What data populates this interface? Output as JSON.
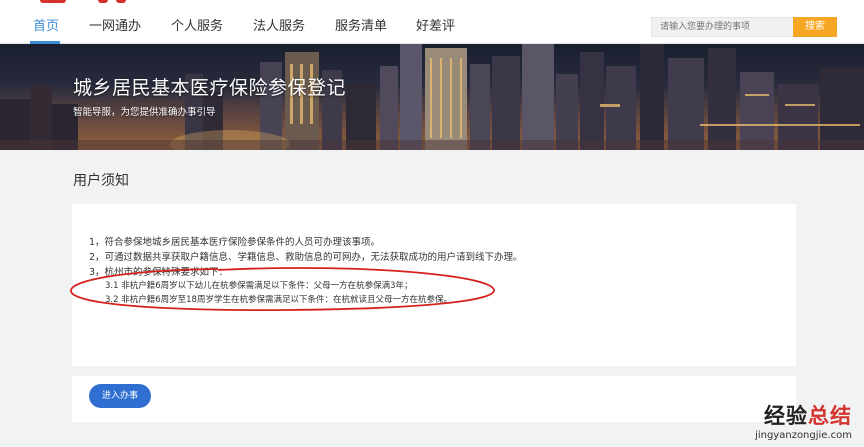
{
  "nav": {
    "items": [
      {
        "label": "首页",
        "active": true
      },
      {
        "label": "一网通办"
      },
      {
        "label": "个人服务"
      },
      {
        "label": "法人服务"
      },
      {
        "label": "服务清单"
      },
      {
        "label": "好差评"
      }
    ],
    "search_placeholder": "请输入您要办理的事项",
    "search_button": "搜索",
    "accent_color": "#3c8ed6",
    "search_button_color": "#f6a623"
  },
  "banner": {
    "title": "城乡居民基本医疗保险参保登记",
    "subtitle": "智能导服，为您提供准确办事引导"
  },
  "notice": {
    "heading": "用户须知",
    "lines": [
      "1，符合参保地城乡居民基本医疗保险参保条件的人员可办理该事项。",
      "2，可通过数据共享获取户籍信息、学籍信息、救助信息的可网办，无法获取成功的用户请到线下办理。",
      "3，杭州市的参保特殊要求如下："
    ],
    "sublines": [
      "3.1  非杭户籍6周岁以下幼儿在杭参保需满足以下条件：父母一方在杭参保满3年；",
      "3.2  非杭户籍6周岁至18周岁学生在杭参保需满足以下条件：在杭就读且父母一方在杭参保。"
    ]
  },
  "action": {
    "enter_button": "进入办事",
    "button_color": "#2f6fd1"
  },
  "watermark": {
    "main_a": "经验",
    "main_b": "总结",
    "url": "jingyanzongjie.com"
  }
}
